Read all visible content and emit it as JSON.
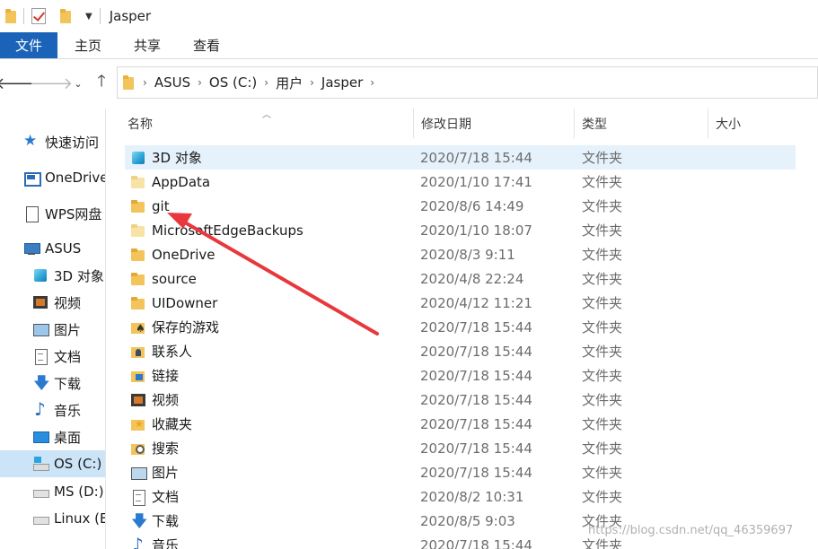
{
  "window": {
    "title": "Jasper"
  },
  "ribbon": {
    "file_tab": "文件",
    "tabs": [
      "主页",
      "共享",
      "查看"
    ]
  },
  "address": {
    "crumbs": [
      "ASUS",
      "OS (C:)",
      "用户",
      "Jasper"
    ]
  },
  "sidebar": {
    "items": [
      {
        "label": "快速访问",
        "icon": "star-icon"
      },
      {
        "label": "OneDrive",
        "icon": "onedrive-icon"
      },
      {
        "label": "WPS网盘",
        "icon": "wps-doc-icon"
      },
      {
        "label": "ASUS",
        "icon": "computer-icon"
      },
      {
        "label": "3D 对象",
        "icon": "cube-icon"
      },
      {
        "label": "视频",
        "icon": "video-icon"
      },
      {
        "label": "图片",
        "icon": "pictures-icon"
      },
      {
        "label": "文档",
        "icon": "documents-icon"
      },
      {
        "label": "下载",
        "icon": "download-icon"
      },
      {
        "label": "音乐",
        "icon": "music-icon"
      },
      {
        "label": "桌面",
        "icon": "desktop-icon"
      },
      {
        "label": "OS (C:)",
        "icon": "drive-c-icon"
      },
      {
        "label": "MS (D:)",
        "icon": "drive-icon"
      },
      {
        "label": "Linux (E",
        "icon": "drive-icon"
      }
    ],
    "selected_index": 11
  },
  "columns": {
    "name": "名称",
    "date": "修改日期",
    "type": "类型",
    "size": "大小"
  },
  "files": [
    {
      "name": "3D 对象",
      "date": "2020/7/18 15:44",
      "type": "文件夹",
      "icon": "cube-icon"
    },
    {
      "name": "AppData",
      "date": "2020/1/10 17:41",
      "type": "文件夹",
      "icon": "folder-icon-pale"
    },
    {
      "name": "git",
      "date": "2020/8/6 14:49",
      "type": "文件夹",
      "icon": "folder-icon"
    },
    {
      "name": "MicrosoftEdgeBackups",
      "date": "2020/1/10 18:07",
      "type": "文件夹",
      "icon": "folder-icon-pale"
    },
    {
      "name": "OneDrive",
      "date": "2020/8/3 9:11",
      "type": "文件夹",
      "icon": "folder-icon"
    },
    {
      "name": "source",
      "date": "2020/4/8 22:24",
      "type": "文件夹",
      "icon": "folder-icon"
    },
    {
      "name": "UIDowner",
      "date": "2020/4/12 11:21",
      "type": "文件夹",
      "icon": "folder-icon"
    },
    {
      "name": "保存的游戏",
      "date": "2020/7/18 15:44",
      "type": "文件夹",
      "icon": "saved-games-icon"
    },
    {
      "name": "联系人",
      "date": "2020/7/18 15:44",
      "type": "文件夹",
      "icon": "contacts-icon"
    },
    {
      "name": "链接",
      "date": "2020/7/18 15:44",
      "type": "文件夹",
      "icon": "links-icon"
    },
    {
      "name": "视频",
      "date": "2020/7/18 15:44",
      "type": "文件夹",
      "icon": "video-icon"
    },
    {
      "name": "收藏夹",
      "date": "2020/7/18 15:44",
      "type": "文件夹",
      "icon": "favorites-icon"
    },
    {
      "name": "搜索",
      "date": "2020/7/18 15:44",
      "type": "文件夹",
      "icon": "searches-icon"
    },
    {
      "name": "图片",
      "date": "2020/7/18 15:44",
      "type": "文件夹",
      "icon": "pictures-icon"
    },
    {
      "name": "文档",
      "date": "2020/8/2 10:31",
      "type": "文件夹",
      "icon": "documents-icon"
    },
    {
      "name": "下载",
      "date": "2020/8/5 9:03",
      "type": "文件夹",
      "icon": "download-icon"
    },
    {
      "name": "音乐",
      "date": "2020/7/18 15:44",
      "type": "文件夹",
      "icon": "music-icon"
    }
  ],
  "selected_file_index": 0,
  "watermark": "https://blog.csdn.net/qq_46359697",
  "colors": {
    "file_tab": "#1a63b8",
    "selected_row": "#e5f1fb",
    "selected_nav": "#cce4f7",
    "arrow": "#e8383d"
  }
}
